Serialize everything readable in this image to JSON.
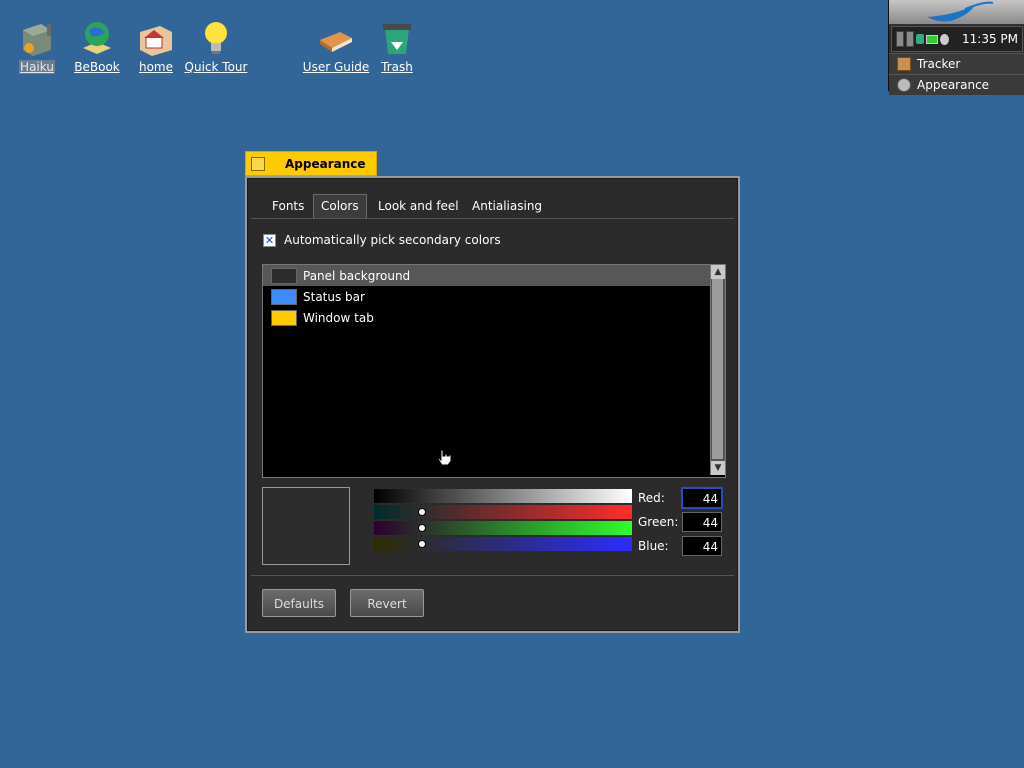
{
  "desktop": {
    "icons": [
      {
        "label": "Haiku",
        "icon": "haiku-drive-icon"
      },
      {
        "label": "BeBook",
        "icon": "bebook-globe-icon"
      },
      {
        "label": "home",
        "icon": "home-folder-icon"
      },
      {
        "label": "Quick Tour",
        "icon": "lightbulb-icon"
      },
      {
        "label": "User Guide",
        "icon": "book-icon"
      },
      {
        "label": "Trash",
        "icon": "trash-icon"
      }
    ]
  },
  "deskbar": {
    "clock": "11:35 PM",
    "items": [
      {
        "label": "Tracker",
        "icon": "tracker-icon"
      },
      {
        "label": "Appearance",
        "icon": "appearance-icon"
      }
    ]
  },
  "window": {
    "title": "Appearance",
    "tabs": [
      {
        "label": "Fonts"
      },
      {
        "label": "Colors",
        "active": true
      },
      {
        "label": "Look and feel"
      },
      {
        "label": "Antialiasing"
      }
    ],
    "auto_pick_label": "Automatically pick secondary colors",
    "auto_pick_checked": true,
    "color_list": [
      {
        "label": "Panel background",
        "color": "#2c2c2c",
        "selected": true
      },
      {
        "label": "Status bar",
        "color": "#3c8cff"
      },
      {
        "label": "Window tab",
        "color": "#ffcb00"
      }
    ],
    "rgb": {
      "red_label": "Red:",
      "red": "44",
      "green_label": "Green:",
      "green": "44",
      "blue_label": "Blue:",
      "blue": "44"
    },
    "buttons": {
      "defaults": "Defaults",
      "revert": "Revert"
    }
  },
  "colors": {
    "desktop": "#336698",
    "window_tab": "#ffcb00",
    "panel": "#2b2b2b"
  }
}
